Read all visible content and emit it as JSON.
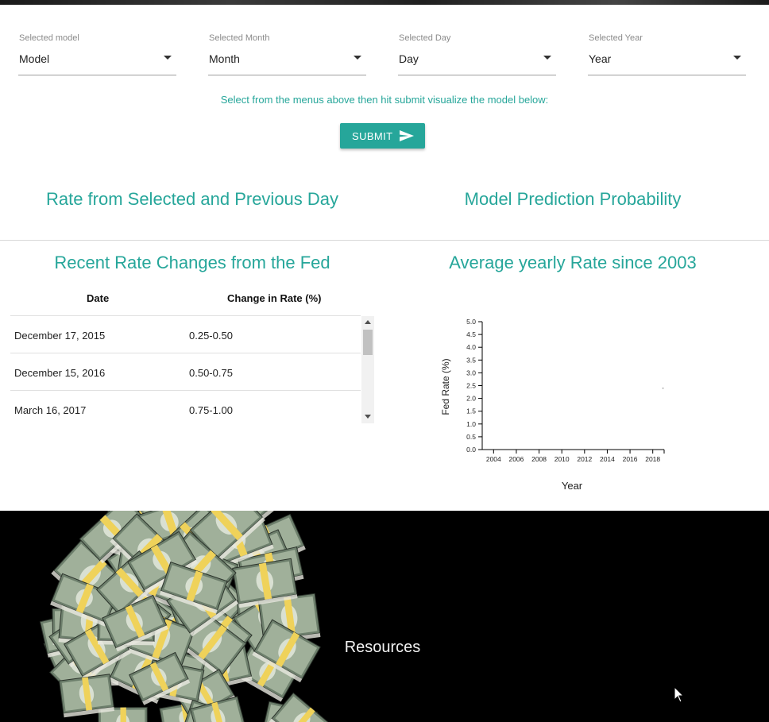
{
  "selects": [
    {
      "label": "Selected model",
      "value": "Model"
    },
    {
      "label": "Selected Month",
      "value": "Month"
    },
    {
      "label": "Selected Day",
      "value": "Day"
    },
    {
      "label": "Selected Year",
      "value": "Year"
    }
  ],
  "hint": "Select from the menus above then hit submit visualize the model below:",
  "submit_label": "SUBMIT",
  "sections": {
    "rate_days": "Rate from Selected and Previous Day",
    "prediction": "Model Prediction Probability",
    "recent_changes": "Recent Rate Changes from the Fed",
    "average_yearly": "Average yearly Rate since 2003"
  },
  "table": {
    "headers": [
      "Date",
      "Change in Rate (%)"
    ],
    "rows": [
      [
        "December 17, 2015",
        "0.25-0.50"
      ],
      [
        "December 15, 2016",
        "0.50-0.75"
      ],
      [
        "March 16, 2017",
        "0.75-1.00"
      ]
    ]
  },
  "chart_data": {
    "type": "line",
    "title": "",
    "xlabel": "Year",
    "ylabel": "Fed Rate (%)",
    "xlim": [
      2003,
      2019
    ],
    "ylim": [
      0,
      5
    ],
    "x_ticks": [
      "2004",
      "2006",
      "2008",
      "2010",
      "2012",
      "2014",
      "2016",
      "2018"
    ],
    "y_ticks": [
      "0.0",
      "0.5",
      "1.0",
      "1.5",
      "2.0",
      "2.5",
      "3.0",
      "3.5",
      "4.0",
      "4.5",
      "5.0"
    ],
    "series": [
      {
        "x": [
          2018.9
        ],
        "y": [
          2.4
        ]
      }
    ]
  },
  "footer": {
    "resources": "Resources"
  },
  "colors": {
    "accent": "#26a69a",
    "footer_bg": "#000000"
  },
  "icons": [
    "dropdown-caret-icon",
    "send-icon",
    "mouse-cursor-icon"
  ]
}
